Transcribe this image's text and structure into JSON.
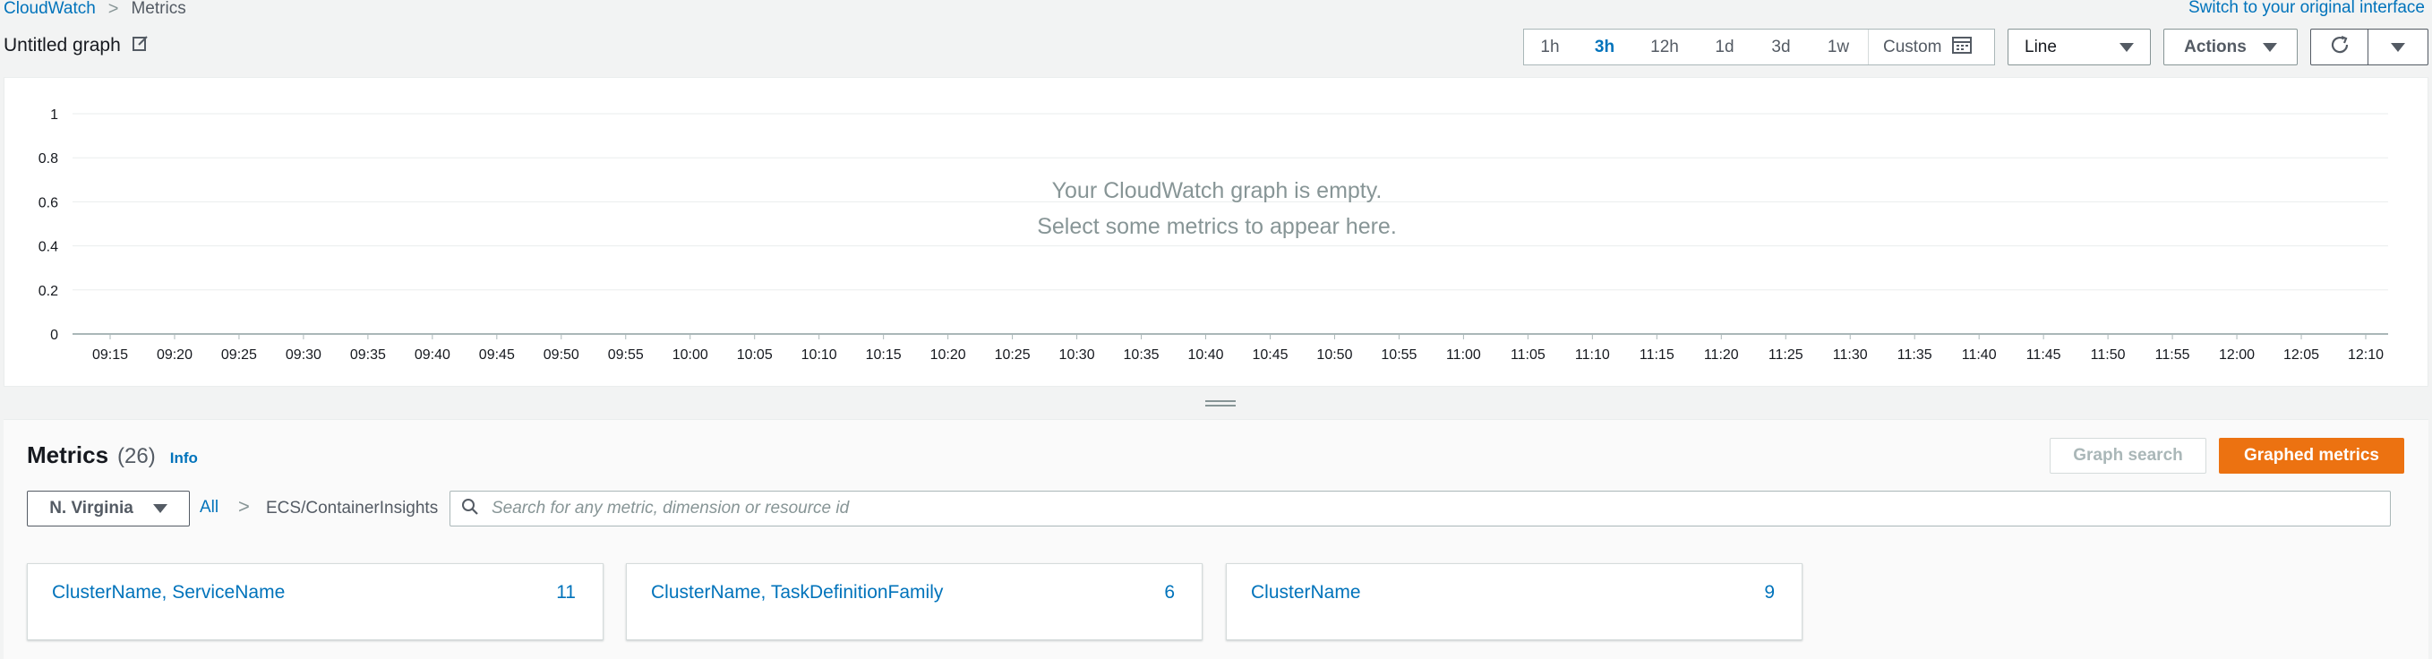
{
  "breadcrumb": {
    "root": "CloudWatch",
    "current": "Metrics"
  },
  "switch_link": "Switch to your original interface",
  "graph": {
    "title": "Untitled graph",
    "empty_line1": "Your CloudWatch graph is empty.",
    "empty_line2": "Select some metrics to appear here.",
    "y_ticks": [
      "1",
      "0.8",
      "0.6",
      "0.4",
      "0.2",
      "0"
    ],
    "x_ticks": [
      "09:15",
      "09:20",
      "09:25",
      "09:30",
      "09:35",
      "09:40",
      "09:45",
      "09:50",
      "09:55",
      "10:00",
      "10:05",
      "10:10",
      "10:15",
      "10:20",
      "10:25",
      "10:30",
      "10:35",
      "10:40",
      "10:45",
      "10:50",
      "10:55",
      "11:00",
      "11:05",
      "11:10",
      "11:15",
      "11:20",
      "11:25",
      "11:30",
      "11:35",
      "11:40",
      "11:45",
      "11:50",
      "11:55",
      "12:00",
      "12:05",
      "12:10"
    ]
  },
  "toolbar": {
    "time_ranges": [
      "1h",
      "3h",
      "12h",
      "1d",
      "3d",
      "1w"
    ],
    "active_range": "3h",
    "custom_label": "Custom",
    "chart_type": "Line",
    "actions_label": "Actions"
  },
  "metrics": {
    "title": "Metrics",
    "count": "(26)",
    "info": "Info",
    "graph_search_label": "Graph search",
    "graphed_metrics_label": "Graphed metrics",
    "region": "N. Virginia",
    "crumb_all": "All",
    "crumb_namespace": "ECS/ContainerInsights",
    "search_placeholder": "Search for any metric, dimension or resource id",
    "cards": [
      {
        "name": "ClusterName, ServiceName",
        "count": "11"
      },
      {
        "name": "ClusterName, TaskDefinitionFamily",
        "count": "6"
      },
      {
        "name": "ClusterName",
        "count": "9"
      }
    ]
  },
  "colors": {
    "link": "#0073bb",
    "primary_button": "#ec7211",
    "grid": "#eaeded"
  },
  "icons": {
    "edit": "edit-icon",
    "calendar": "calendar-icon",
    "refresh": "refresh-icon",
    "search": "search-icon"
  }
}
